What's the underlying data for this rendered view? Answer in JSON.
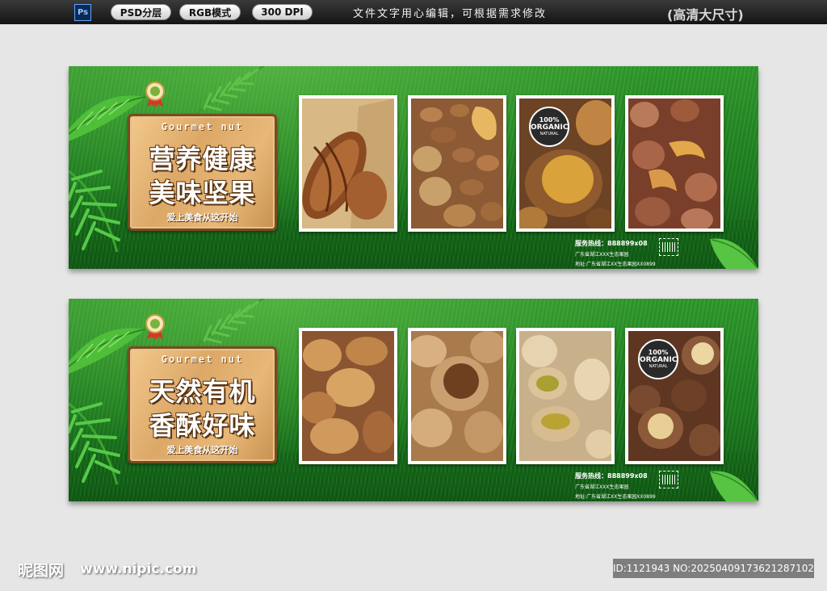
{
  "header": {
    "ps_label": "Ps",
    "badges": [
      "PSD分层",
      "RGB模式",
      "300 DPI"
    ],
    "note": "文件文字用心编辑，可根据需求修改",
    "resolution_label": "(高清大尺寸)"
  },
  "banners": [
    {
      "board_en": "Gourmet nut",
      "title_line1": "营养健康",
      "title_line2": "美味坚果",
      "subtitle": "爱上美食从这开始",
      "photos": [
        "pecan",
        "almond-walnut-cashew",
        "chestnut",
        "cashew"
      ],
      "organic_badge": {
        "top": "100%",
        "middle": "ORGANIC",
        "bottom": "NATURAL"
      },
      "organic_on_photo": 3,
      "info": {
        "line1": "服务热线：888899x08",
        "line2": "广东省湖江XXX生态果园",
        "line3": "地址:广东省湖江XX生态果园XX0899"
      }
    },
    {
      "board_en": "Gourmet nut",
      "title_line1": "天然有机",
      "title_line2": "香酥好味",
      "subtitle": "爱上美食从这开始",
      "photos": [
        "almond",
        "walnut",
        "pistachio",
        "macadamia"
      ],
      "organic_badge": {
        "top": "100%",
        "middle": "ORGANIC",
        "bottom": "NATURAL"
      },
      "organic_on_photo": 4,
      "info": {
        "line1": "服务热线：888899x08",
        "line2": "广东省湖江XXX生态果园",
        "line3": "地址:广东省湖江XX生态果园XX0899"
      }
    }
  ],
  "footer": {
    "logo": "昵图网",
    "url": "www.nipic.com",
    "id_text": "ID:1121943 NO:20250409173621287102"
  },
  "colors": {
    "grass": "#1d7e1f",
    "wood": "#dca868",
    "wood_border": "#7a4a1e",
    "bg": "#e6e6e6"
  }
}
